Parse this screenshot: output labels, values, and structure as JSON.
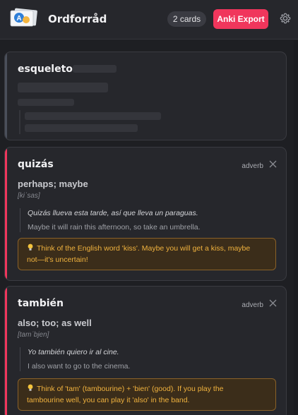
{
  "header": {
    "app_title": "Ordforråd",
    "card_count": "2 cards",
    "export_label": "Anki Export",
    "logo_text": "A"
  },
  "colors": {
    "accent": "#f0365c",
    "loading_accent": "#4a4f5a",
    "tip_text": "#f0b23e"
  },
  "loading_card": {
    "word": "esqueleto"
  },
  "cards": [
    {
      "word": "quizás",
      "pos": "adverb",
      "meaning": "perhaps; maybe",
      "ipa": "[kiˈsas]",
      "example_es": "Quizás llueva esta tarde, así que lleva un paraguas.",
      "example_en": "Maybe it will rain this afternoon, so take an umbrella.",
      "tip_line1": "Think of the English word 'kiss'. Maybe you will get a kiss, maybe",
      "tip_line2": "not—it's uncertain!"
    },
    {
      "word": "también",
      "pos": "adverb",
      "meaning": "also; too; as well",
      "ipa": "[tamˈbjen]",
      "example_es": "Yo también quiero ir al cine.",
      "example_en": "I also want to go to the cinema.",
      "tip_line1": "Think of 'tam' (tambourine) + 'bien' (good). If you play the",
      "tip_line2": "tambourine well, you can play it 'also' in the band."
    }
  ]
}
